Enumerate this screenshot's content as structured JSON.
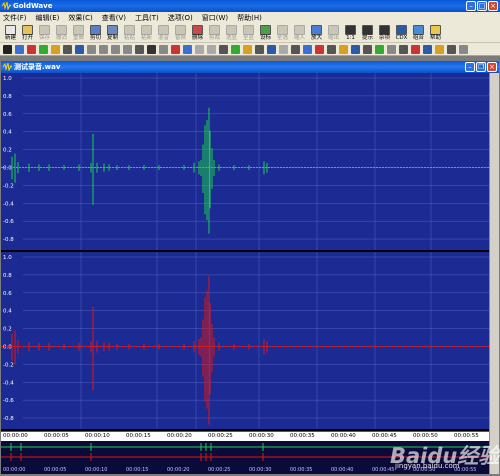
{
  "app": {
    "title": "GoldWave"
  },
  "menu": [
    "文件(F)",
    "编辑(E)",
    "效果(C)",
    "查看(V)",
    "工具(T)",
    "选项(O)",
    "窗口(W)",
    "帮助(H)"
  ],
  "toolbar": [
    {
      "label": "新建",
      "icon": "new-file-icon",
      "enabled": true
    },
    {
      "label": "打开",
      "icon": "open-folder-icon",
      "enabled": true
    },
    {
      "label": "保存",
      "icon": "save-icon",
      "enabled": false
    },
    {
      "label": "撤消",
      "icon": "undo-icon",
      "enabled": false
    },
    {
      "label": "重做",
      "icon": "redo-icon",
      "enabled": false
    },
    {
      "label": "剪切",
      "icon": "cut-icon",
      "enabled": true
    },
    {
      "label": "复制",
      "icon": "copy-icon",
      "enabled": true
    },
    {
      "label": "粘贴",
      "icon": "paste-icon",
      "enabled": false
    },
    {
      "label": "粘新",
      "icon": "paste-new-icon",
      "enabled": false
    },
    {
      "label": "混音",
      "icon": "mix-icon",
      "enabled": false
    },
    {
      "label": "替换",
      "icon": "replace-icon",
      "enabled": false
    },
    {
      "label": "删除",
      "icon": "delete-icon",
      "enabled": true
    },
    {
      "label": "剪裁",
      "icon": "trim-icon",
      "enabled": false
    },
    {
      "label": "选显",
      "icon": "select-view-icon",
      "enabled": false
    },
    {
      "label": "全显",
      "icon": "show-all-icon",
      "enabled": false
    },
    {
      "label": "设标",
      "icon": "set-marker-icon",
      "enabled": true
    },
    {
      "label": "全选",
      "icon": "select-all-icon",
      "enabled": false
    },
    {
      "label": "缩入",
      "icon": "zoom-in-icon",
      "enabled": false
    },
    {
      "label": "放大",
      "icon": "zoom-icon",
      "enabled": true
    },
    {
      "label": "缩出",
      "icon": "zoom-out-icon",
      "enabled": false
    },
    {
      "label": "1:1",
      "icon": "zoom-1-1-icon",
      "enabled": true
    },
    {
      "label": "提示",
      "icon": "cue-icon",
      "enabled": true
    },
    {
      "label": "杂项",
      "icon": "misc-icon",
      "enabled": true
    },
    {
      "label": "CDX",
      "icon": "cdx-icon",
      "enabled": true
    },
    {
      "label": "组合",
      "icon": "combine-icon",
      "enabled": true
    },
    {
      "label": "帮助",
      "icon": "help-icon",
      "enabled": true
    }
  ],
  "document": {
    "title": "测试录音.wav"
  },
  "channels": [
    {
      "name": "left",
      "color": "#19d24a",
      "ticks": [
        "1.0",
        "0.8",
        "0.6",
        "0.4",
        "0.2",
        "0.0",
        "-0.2",
        "-0.4",
        "-0.6",
        "-0.8"
      ]
    },
    {
      "name": "right",
      "color": "#e01515",
      "ticks": [
        "1.0",
        "0.8",
        "0.6",
        "0.4",
        "0.2",
        "0.0",
        "-0.2",
        "-0.4",
        "-0.6",
        "-0.8"
      ]
    }
  ],
  "timeline": [
    "00:00:00",
    "00:00:05",
    "00:00:10",
    "00:00:15",
    "00:00:20",
    "00:00:25",
    "00:00:30",
    "00:00:35",
    "00:00:40",
    "00:00:45",
    "00:00:50",
    "00:00:55"
  ],
  "overview_timeline": [
    "00:00:00",
    "00:00:05",
    "00:00:10",
    "00:00:15",
    "00:00:20",
    "00:00:25",
    "00:00:30",
    "00:00:35",
    "00:00:40",
    "00:00:45",
    "00:00:50",
    "00:00:55"
  ],
  "colors": {
    "wave_bg": "#1c2b93",
    "grid": "#5060c0",
    "left_wave": "#19d24a",
    "right_wave": "#e01515"
  },
  "watermark": {
    "brand": "Baidu经验",
    "url": "jingyan.baidu.com"
  }
}
